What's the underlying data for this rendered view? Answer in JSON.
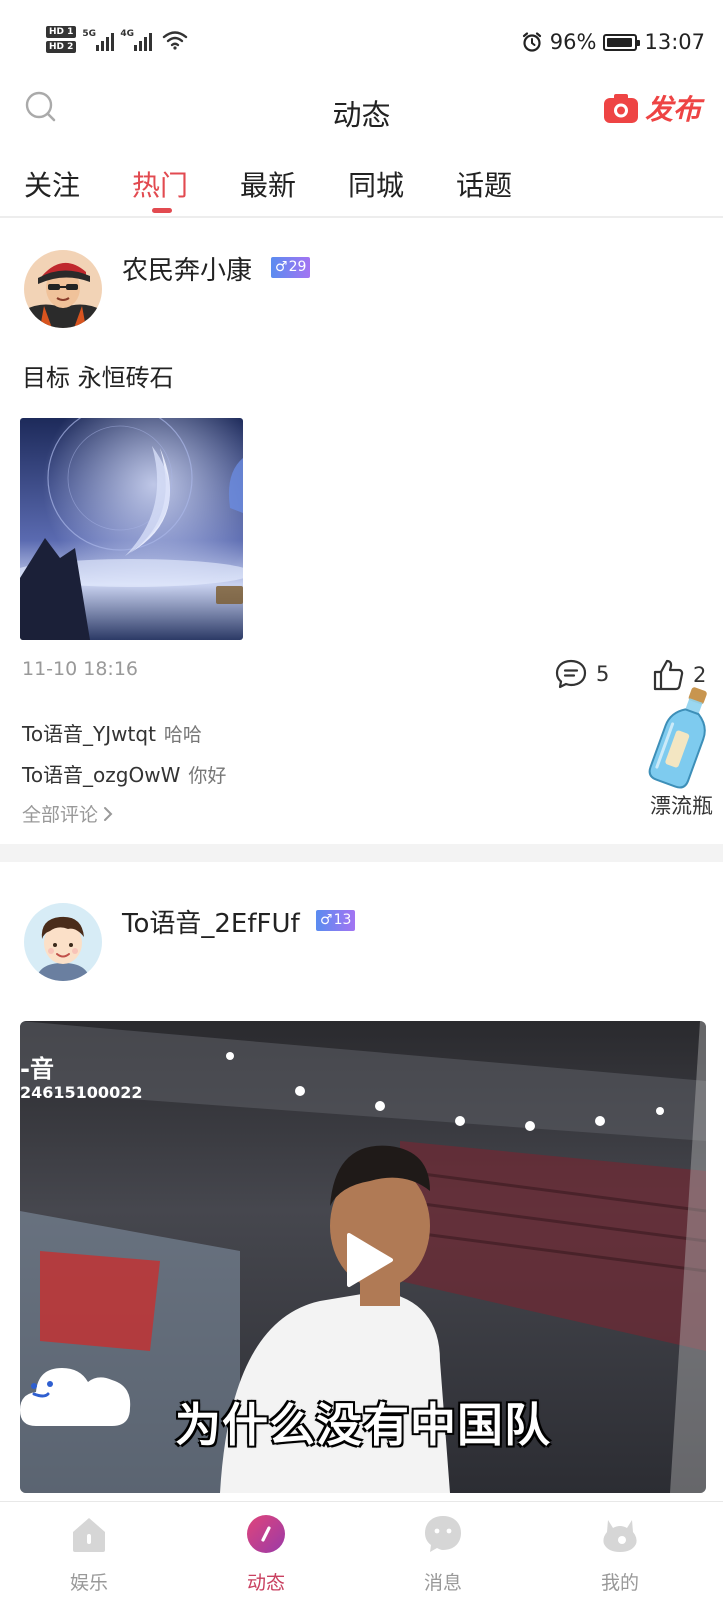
{
  "status_bar": {
    "hd1": "HD 1",
    "hd2": "HD 2",
    "net1": "5G",
    "net2": "4G",
    "battery": "96%",
    "battery_level": 0.96,
    "time": "13:07"
  },
  "header": {
    "title": "动态",
    "publish_label": "发布",
    "accent_color": "#e24a50"
  },
  "tabs": [
    {
      "label": "关注",
      "active": false
    },
    {
      "label": "热门",
      "active": true
    },
    {
      "label": "最新",
      "active": false
    },
    {
      "label": "同城",
      "active": false
    },
    {
      "label": "话题",
      "active": false
    }
  ],
  "posts": [
    {
      "username": "农民奔小康",
      "gender_symbol": "♂",
      "age": "29",
      "text": "目标 永恒砖石",
      "timestamp": "11-10 18:16",
      "comment_count": "5",
      "like_count": "2",
      "comments": [
        {
          "user": "To语音_YJwtqt",
          "text": "哈哈"
        },
        {
          "user": "To语音_ozgOwW",
          "text": "你好"
        }
      ],
      "all_comments_label": "全部评论"
    },
    {
      "username": "To语音_2EfFUf",
      "gender_symbol": "♂",
      "age": "13",
      "video": {
        "caption": "为什么没有中国队",
        "watermark_title": "-音",
        "watermark_id": "24615100022"
      }
    }
  ],
  "floating": {
    "bottle_label": "漂流瓶"
  },
  "bottom_nav": [
    {
      "label": "娱乐",
      "icon": "home-icon",
      "active": false
    },
    {
      "label": "动态",
      "icon": "moments-icon",
      "active": true
    },
    {
      "label": "消息",
      "icon": "chat-icon",
      "active": false
    },
    {
      "label": "我的",
      "icon": "profile-icon",
      "active": false
    }
  ]
}
